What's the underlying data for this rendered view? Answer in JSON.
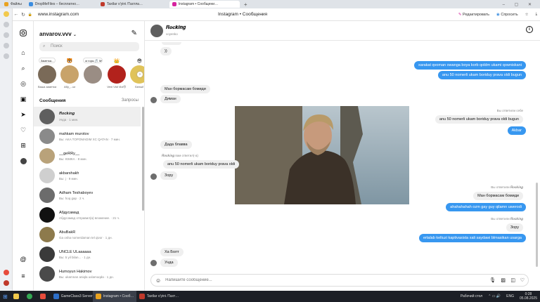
{
  "browser": {
    "tabs": [
      {
        "label": "Файлы",
        "color": "#e9a21f"
      },
      {
        "label": "DropMeFiles – бесплатно…",
        "color": "#3b8de0"
      },
      {
        "label": "Taxtlar o'yini /Тахтла…",
        "color": "#c0392b"
      },
      {
        "label": "Instagram • Сообщени…",
        "color": "#d6249f"
      }
    ],
    "url": "www.instagram.com",
    "page_title": "Instagram • Сообщения",
    "edit_label": "Редактировать",
    "ask_label": "Спросить"
  },
  "sidebar": {
    "username": "anvarov.vvv",
    "search_placeholder": "Поиск",
    "notes": [
      {
        "bubble": "Заметка...",
        "name": "Ваша заметка",
        "color": "#7a6a58"
      },
      {
        "bubble": "",
        "name": "Абу_...ка",
        "color": "#c8a36a"
      },
      {
        "bubble": "м горы 🎵 Мурод & Anis…",
        "name": "",
        "color": "#9a8d84"
      },
      {
        "bubble": "",
        "name": "Veni Vidi Vici😍",
        "color": "#b2221c"
      },
      {
        "bubble": "",
        "name": "Белый",
        "color": "#e0c35a"
      }
    ],
    "messages_header": "Сообщения",
    "requests_label": "Запросы",
    "conversations": [
      {
        "name": "𝑹𝒐𝒄𝒌𝒊𝒏𝒈",
        "preview": "Унда · 1 мин.",
        "color": "#5f5f5f",
        "selected": true
      },
      {
        "name": "mahkam murotov",
        "preview": "Вы: AKA TOPOMADIM XC QATAN · 7 мин.",
        "color": "#8a8a8a",
        "selected": false
      },
      {
        "name": "__geRRy__",
        "preview": "Вы: ЮМКА · 8 мин.",
        "color": "#b9a27a",
        "selected": false
      },
      {
        "name": "akbarshakh",
        "preview": "Вы: j · 9 мин.",
        "color": "#cfcfcf",
        "selected": false
      },
      {
        "name": "Adham Teshaboyev",
        "preview": "Вы: hoq gap · 2 ч.",
        "color": "#6c6c6c",
        "selected": false
      },
      {
        "name": "Абдусамад",
        "preview": "Абдусамад отправил(а) вложение. · 21 ч.",
        "color": "#111111",
        "selected": false
      },
      {
        "name": "AbuBakR",
        "preview": "Ga osha nomerdaman tel qivor · 1 дн.",
        "color": "#8d7a4c",
        "selected": false
      },
      {
        "name": "UNCLE ULaaaaaa",
        "preview": "Вы: 5 yil bilan... · 1 дн.",
        "color": "#3a3a3a",
        "selected": false
      },
      {
        "name": "Humoyun Hakimov",
        "preview": "Вы: ukamnan aniqla uxlamoqda · 1 дн.",
        "color": "#4a4a4a",
        "selected": false
      }
    ]
  },
  "chat": {
    "contact_name": "𝑹𝒐𝒄𝒌𝒊𝒏𝒈",
    "contact_handle": "voyenko",
    "messages": [
      {
        "kind": "in",
        "text": "))"
      },
      {
        "kind": "out",
        "text": "xarakat qvoman owanga boya korb qoldm ukami qowniskani"
      },
      {
        "kind": "out",
        "text": "anu 50 nomerli ukam boriduy prava oldi bugun"
      },
      {
        "kind": "in",
        "text": "Ман бормасам бомиди"
      },
      {
        "kind": "in",
        "text": "Диман"
      },
      {
        "kind": "label",
        "text": "Вы ответили себе"
      },
      {
        "kind": "in",
        "text": "anu 50 nomerli ukam boriduy prava oldi bugun"
      },
      {
        "kind": "out",
        "text": "Akbar"
      },
      {
        "kind": "in",
        "text": "Дада блавва"
      },
      {
        "kind": "label",
        "text": "𝑹𝒐𝒄𝒌𝒊𝒏𝒈 вам ответил(-а)"
      },
      {
        "kind": "in",
        "text": "anu 50 nomerli ukam boriduy prava oldi"
      },
      {
        "kind": "in",
        "text": "Зору"
      },
      {
        "kind": "label",
        "text": "Вы ответили 𝑹𝒐𝒄𝒌𝒊𝒏𝒈"
      },
      {
        "kind": "in",
        "text": "Ман бормасам бомиди"
      },
      {
        "kind": "out",
        "text": "ahahahahah ozm gay guy qilamn uwerodi"
      },
      {
        "kind": "label",
        "text": "Вы ответили 𝑹𝒐𝒄𝒌𝒊𝒏𝒈"
      },
      {
        "kind": "in",
        "text": "Зору"
      },
      {
        "kind": "out",
        "text": "ertalab keltuzi kaptivasista xali saydawi blmasikan usarga"
      },
      {
        "kind": "in",
        "text": "Ха Болт"
      },
      {
        "kind": "in",
        "text": "Унда"
      }
    ],
    "composer_placeholder": "Напишите сообщение..."
  },
  "taskbar": {
    "items": [
      {
        "label": "GameClass3 Server",
        "color": "#2d6fc9"
      },
      {
        "label": "Instagram • Сооб…",
        "color": "#e9a21f"
      },
      {
        "label": "Taxtlar o'yini /Тахт…",
        "color": "#c0392b"
      }
    ],
    "desktop_label": "Рабочий стол",
    "lang": "ENG",
    "time": "0:28",
    "date": "05.08.2025"
  }
}
